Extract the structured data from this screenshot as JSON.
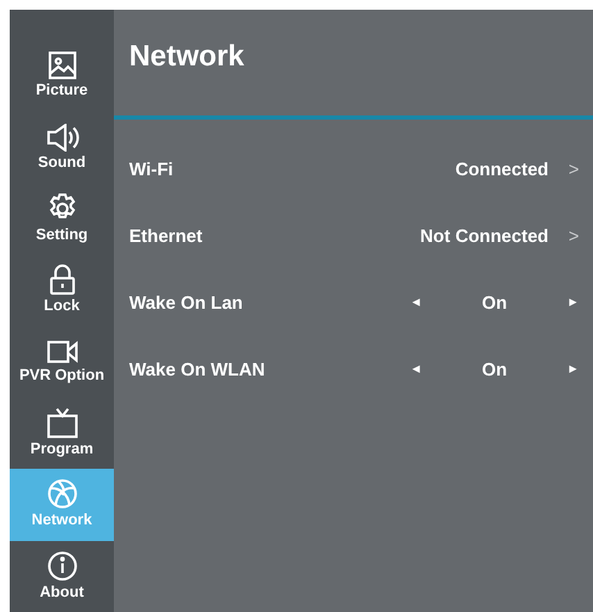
{
  "sidebar": {
    "items": [
      {
        "label": "Picture",
        "selected": false
      },
      {
        "label": "Sound",
        "selected": false
      },
      {
        "label": "Setting",
        "selected": false
      },
      {
        "label": "Lock",
        "selected": false
      },
      {
        "label": "PVR Option",
        "selected": false
      },
      {
        "label": "Program",
        "selected": false
      },
      {
        "label": "Network",
        "selected": true
      },
      {
        "label": "About",
        "selected": false
      }
    ]
  },
  "panel": {
    "title": "Network",
    "rows": [
      {
        "kind": "link",
        "label": "Wi-Fi",
        "value": "Connected",
        "arrow": ">"
      },
      {
        "kind": "link",
        "label": "Ethernet",
        "value": "Not Connected",
        "arrow": ">"
      },
      {
        "kind": "toggle",
        "label": "Wake On Lan",
        "value": "On",
        "left": "◄",
        "right": "►"
      },
      {
        "kind": "toggle",
        "label": "Wake On WLAN",
        "value": "On",
        "left": "◄",
        "right": "►"
      }
    ]
  }
}
